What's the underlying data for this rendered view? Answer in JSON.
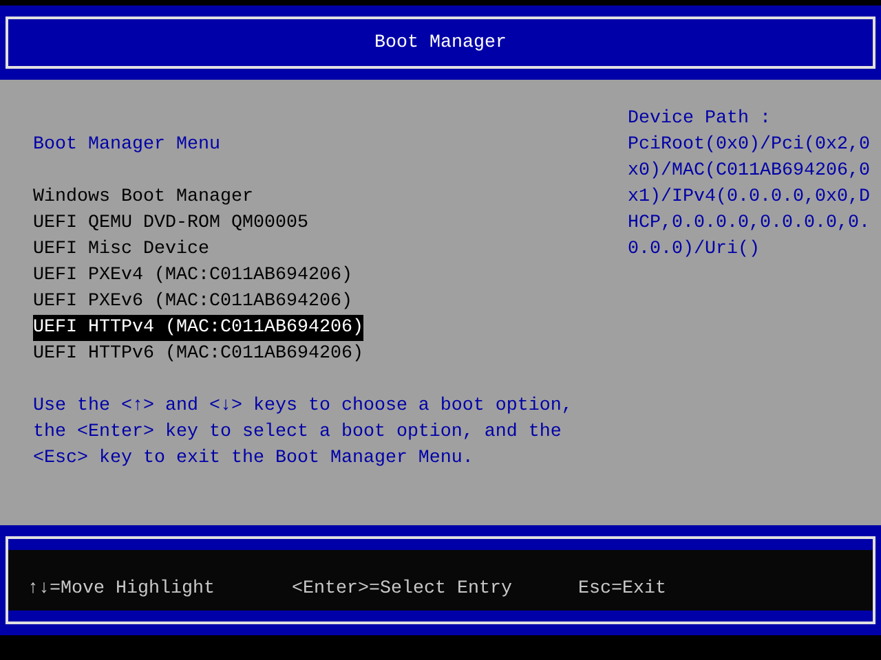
{
  "header": {
    "title": "Boot Manager"
  },
  "menu": {
    "title": "Boot Manager Menu",
    "items": [
      {
        "label": "Windows Boot Manager",
        "selected": false
      },
      {
        "label": "UEFI QEMU DVD-ROM QM00005",
        "selected": false
      },
      {
        "label": "UEFI Misc Device",
        "selected": false
      },
      {
        "label": "UEFI PXEv4 (MAC:C011AB694206)",
        "selected": false
      },
      {
        "label": "UEFI PXEv6 (MAC:C011AB694206)",
        "selected": false
      },
      {
        "label": "UEFI HTTPv4 (MAC:C011AB694206)",
        "selected": true
      },
      {
        "label": "UEFI HTTPv6 (MAC:C011AB694206)",
        "selected": false
      }
    ],
    "help": "Use the <↑> and <↓> keys to choose a boot option, the <Enter> key to select a boot option, and the <Esc> key to exit the Boot Manager Menu."
  },
  "device_path": {
    "label": "Device Path :",
    "value": "PciRoot(0x0)/Pci(0x2,0x0)/MAC(C011AB694206,0x1)/IPv4(0.0.0.0,0x0,DHCP,0.0.0.0,0.0.0.0,0.0.0.0)/Uri()"
  },
  "footer": {
    "hints": [
      "↑↓=Move Highlight",
      "<Enter>=Select Entry",
      "Esc=Exit"
    ]
  }
}
